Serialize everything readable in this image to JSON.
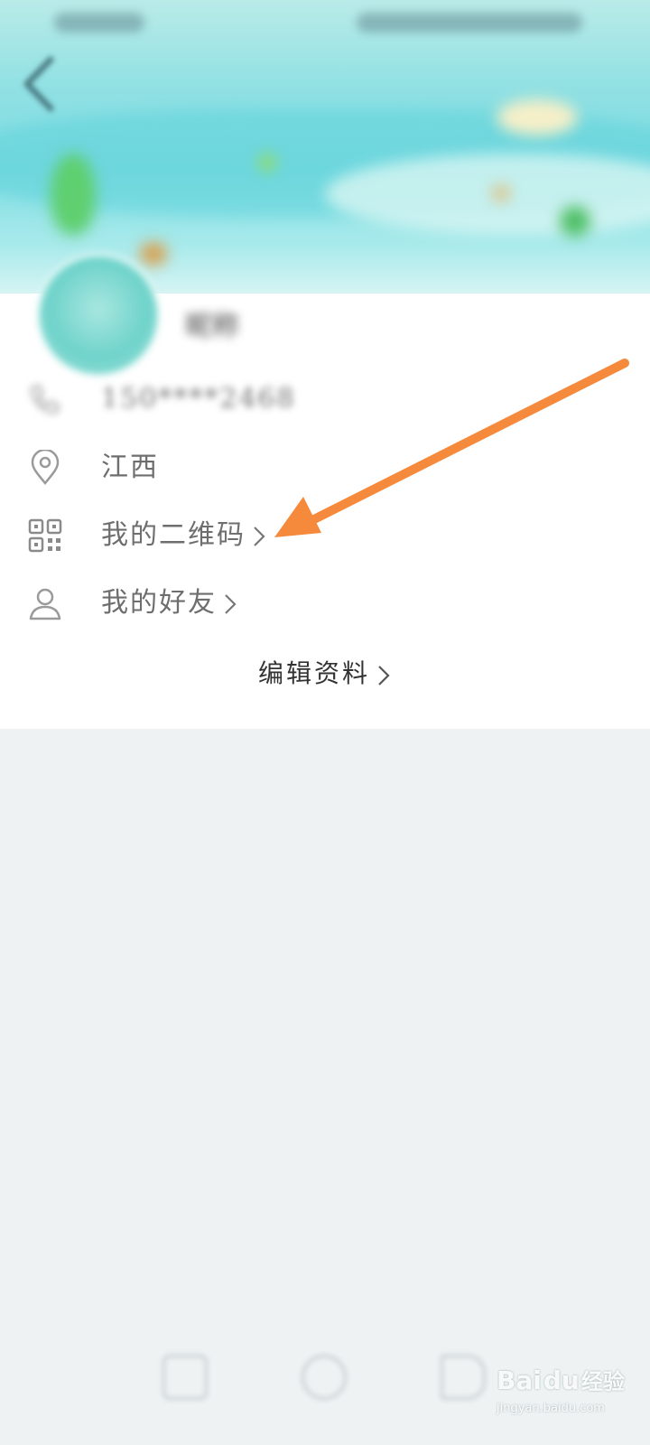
{
  "profile": {
    "nickname": "昵称",
    "phone": "150****2468",
    "location": "江西"
  },
  "menu": {
    "qr_code_label": "我的二维码",
    "friends_label": "我的好友",
    "edit_profile_label": "编辑资料"
  },
  "annotation": {
    "arrow_color": "#f58a3c",
    "arrow_target": "qr-code-row"
  },
  "watermark": {
    "brand": "Bai",
    "paw": "du",
    "suffix": "经验",
    "url": "jingyan.baidu.com"
  },
  "colors": {
    "header_teal": "#7fdde3",
    "page_bg": "#eef2f3",
    "icon_gray": "#9a9a9a"
  },
  "icons": [
    "back-arrow-icon",
    "phone-icon",
    "location-pin-icon",
    "qr-code-icon",
    "person-icon",
    "chevron-right-icon"
  ]
}
